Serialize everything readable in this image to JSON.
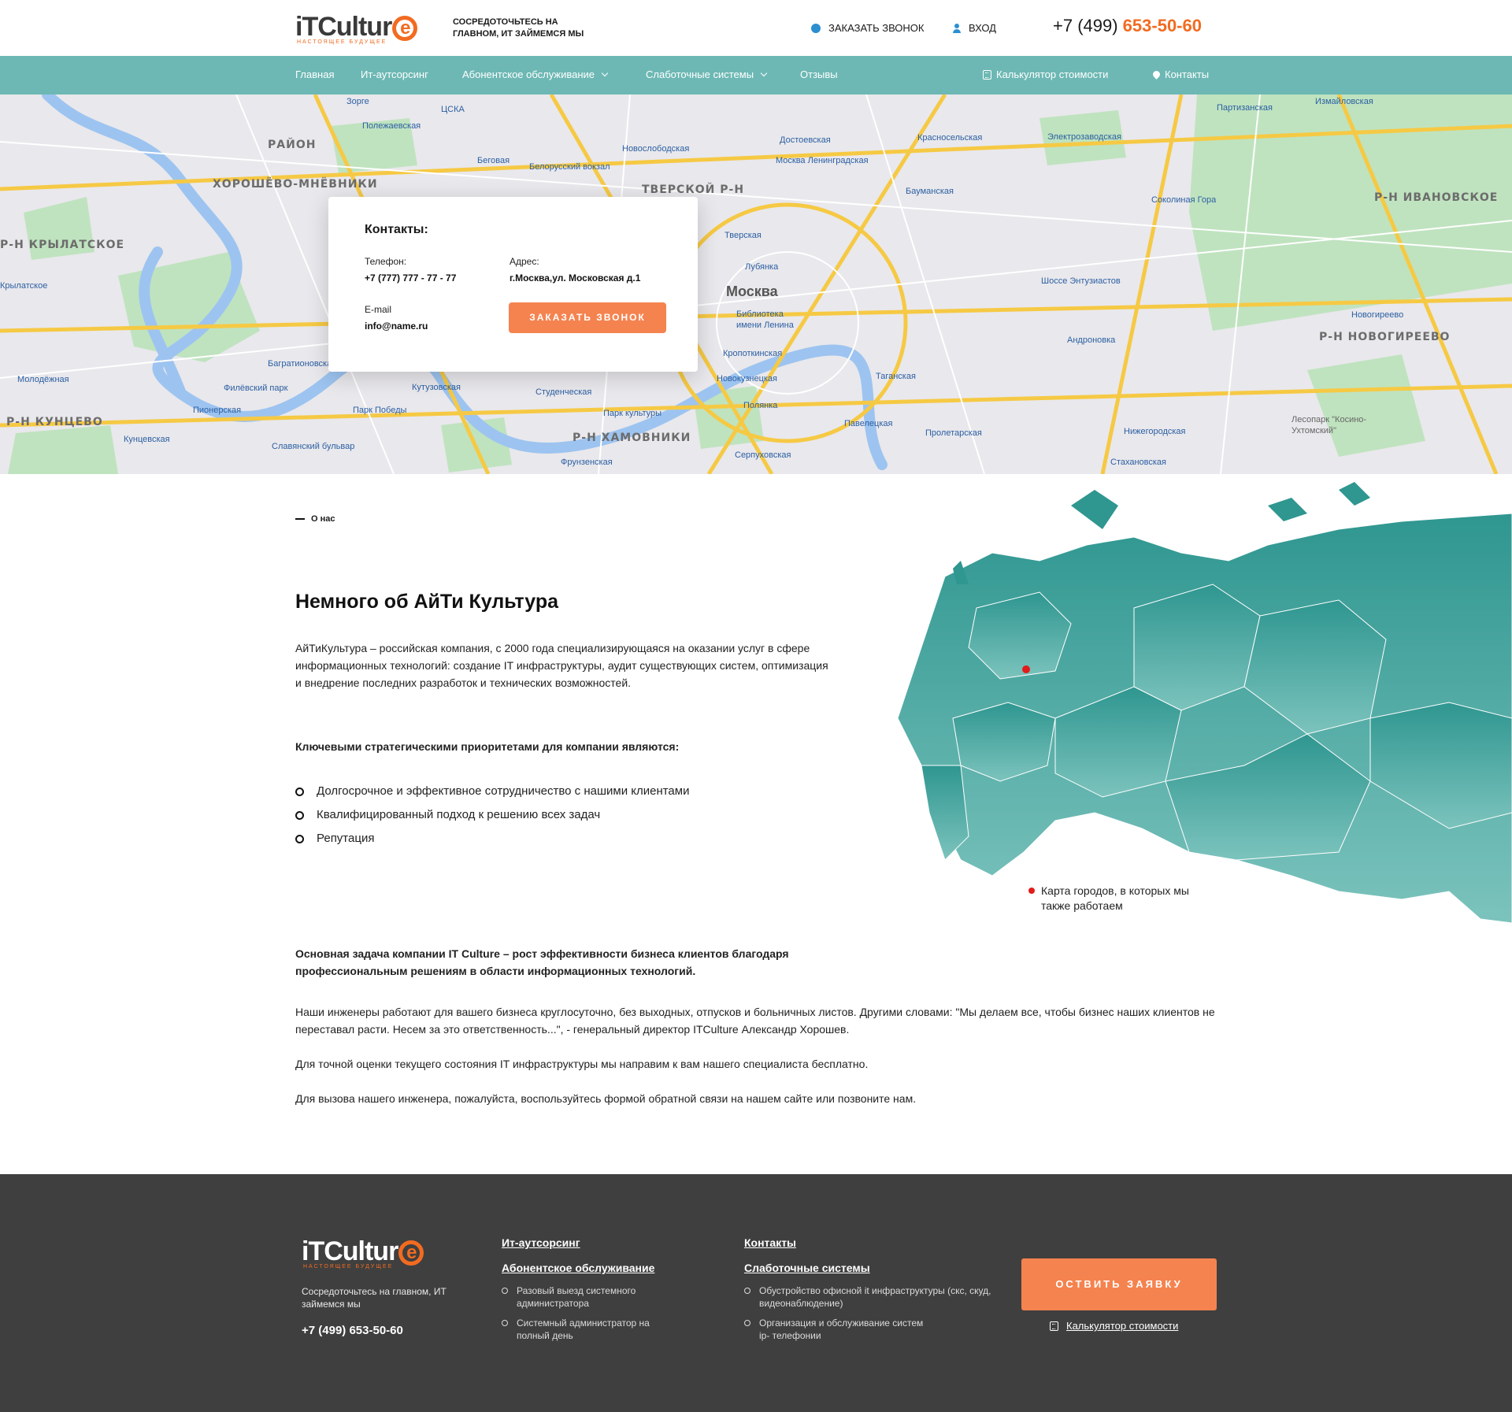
{
  "header": {
    "logo_text": "iTCultur",
    "logo_letter": "e",
    "logo_sub": "НАСТОЯЩЕЕ БУДУЩЕЕ",
    "tagline": "СОСРЕДОТОЧЬТЕСЬ НА ГЛАВНОМ, ИТ ЗАЙМЕМСЯ МЫ",
    "call_label": "ЗАКАЗАТЬ ЗВОНОК",
    "login_label": "ВХОД",
    "phone_prefix": "+7 (499) ",
    "phone_main": "653-50-60"
  },
  "nav": {
    "items": [
      "Главная",
      "Ит-аутсорсинг",
      "Абонентское обслуживание",
      "Слаботочные системы",
      "Отзывы"
    ],
    "calc_label": "Калькулятор стоимости",
    "contacts_label": "Контакты"
  },
  "map": {
    "labels": [
      "Зорге",
      "ЦСКА",
      "Полежаевская",
      "РАЙОН",
      "ХОРОШЁВО-МНЁВНИКИ",
      "Беговая",
      "Белорусский вокзал",
      "Новослободская",
      "Достоевская",
      "Москва Ленинградская",
      "ТВЕРСКОЙ Р-Н",
      "Красносельская",
      "Электрозаводская",
      "Партизанская",
      "Измайловская",
      "Р-Н ИВАНОВСКОЕ",
      "Соколиная Гора",
      "Р-Н КРЫЛАТСКОЕ",
      "Москва",
      "Бауманская",
      "Тверская",
      "Лубянка",
      "Шоссе Энтузиастов",
      "Новогиреево",
      "Р-Н НОВОГИРЕЕВО",
      "Андроновка",
      "Библиотека имени Ленина",
      "Кропоткинская",
      "Таганская",
      "Багратионовская",
      "Молодёжная",
      "Филёвский парк",
      "Кутузовская",
      "Студенческая",
      "Новокузнецкая",
      "Пионерская",
      "Парк Победы",
      "Парк культуры",
      "Полянка",
      "Павелецкая",
      "Р-Н КУНЦЕВО",
      "Кунцевская",
      "Славянский бульвар",
      "Р-Н ХАМОВНИКИ",
      "Серпуховская",
      "Пролетарская",
      "Нижегородская",
      "Лесопарк \"Косино-Ухтомский\"",
      "Фрунзенская",
      "Стахановская",
      "Крылатское"
    ]
  },
  "contacts": {
    "title": "Контакты:",
    "phone_label": "Телефон:",
    "phone_value": "+7 (777) 777 - 77 - 77",
    "address_label": "Адрес:",
    "address_value": "г.Москва,ул. Московская д.1",
    "email_label": "E-mail",
    "email_value": "info@name.ru",
    "button": "ЗАКАЗАТЬ ЗВОНОК"
  },
  "about": {
    "crumb": "О нас",
    "title": "Немного об АйТи Культура",
    "intro": "АйТиКультура – российская компания, с 2000 года специализирующаяся на оказании услуг в сфере информационных технологий: создание IT инфраструктуры, аудит существующих систем, оптимизация и внедрение последних разработок и технических возможностей.",
    "priorities_heading": "Ключевыми стратегическими приоритетами для компании являются:",
    "priorities": [
      "Долгосрочное и эффективное сотрудничество с нашими клиентами",
      "Квалифицированный подход к решению всех задач",
      "Репутация"
    ],
    "mission": "Основная задача компании IT Culture – рост эффективности бизнеса клиентов благодаря профессиональным решениям в области информационных технологий.",
    "p1": "Наши инженеры работают для вашего бизнеса круглосуточно, без выходных, отпусков и больничных листов. Другими словами: \"Мы делаем все, чтобы бизнес наших клиентов не переставал расти. Несем за это ответственность...\", - генеральный директор ITCulture Александр Хорошев.",
    "p2": "Для точной оценки текущего состояния IT инфраструктуры мы направим к вам нашего специалиста бесплатно.",
    "p3": "Для вызова нашего инженера, пожалуйста, воспользуйтесь формой обратной связи на нашем сайте или позвоните нам.",
    "map_note": "Карта городов, в которых мы также работаем"
  },
  "footer": {
    "tagline": "Сосредоточьтесь на главном, ИТ займемся мы",
    "phone": "+7 (499) 653-50-60",
    "col1_heading1": "Ит-аутсорсинг",
    "col1_heading2": "Абонентское обслуживание",
    "col1_items": [
      "Разовый выезд системного администратора",
      "Системный администратор на полный день"
    ],
    "col2_heading1": "Контакты",
    "col2_heading2": "Слаботочные системы",
    "col2_items": [
      "Обустройство офисной it инфраструктуры (скс, скуд, видеонаблюдение)",
      "Организация и обслуживание систем ip- телефонии"
    ],
    "button": "ОСТВИТЬ ЗАЯВКУ",
    "calc_label": "Калькулятор стоимости"
  },
  "colors": {
    "accent": "#f26b21",
    "nav": "#6db8b4",
    "button": "#f5834f",
    "footer": "#3f3f3f",
    "russia": "#2f9690"
  }
}
